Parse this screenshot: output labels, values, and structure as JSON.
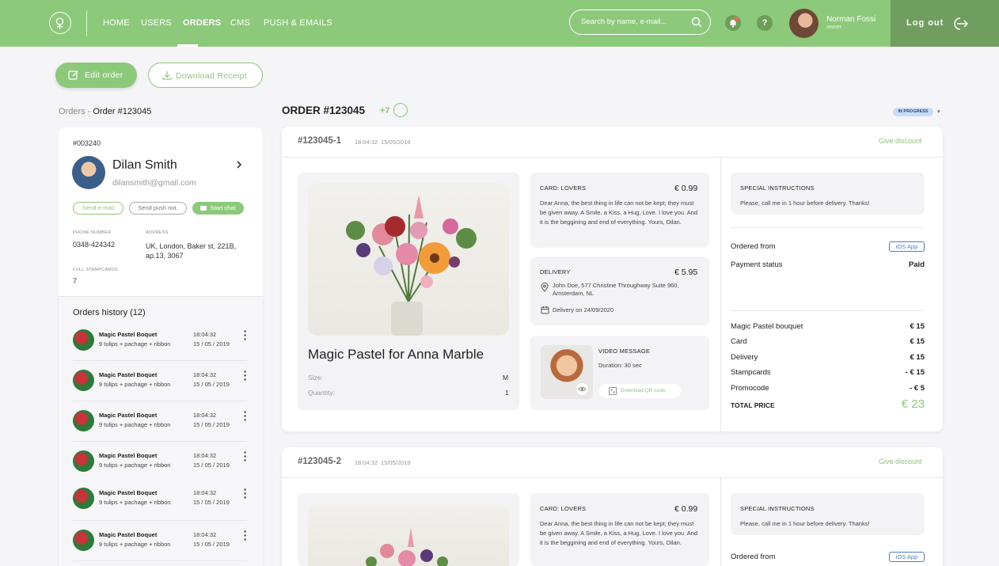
{
  "header": {
    "nav": [
      "HOME",
      "USERS",
      "ORDERS",
      "CMS",
      "PUSH & EMAILS"
    ],
    "active_nav": "ORDERS",
    "search_placeholder": "Search by name, e-mail...",
    "help_label": "?",
    "user_name": "Norman Fossi",
    "user_role": "owner",
    "logout_label": "Log out"
  },
  "actions": {
    "edit_label": "Edit order",
    "download_label": "Download Receipt"
  },
  "breadcrumb": {
    "parent": "Orders",
    "sep": " - ",
    "current": "Order #123045"
  },
  "customer": {
    "id": "#003240",
    "name": "Dilan Smith",
    "email": "dilansmith@gmail.com",
    "buttons": [
      "Send e-mail",
      "Send push not.",
      "Start chat"
    ],
    "phone_label": "PHONE NUMBER",
    "phone": "0348-424342",
    "address_label": "ADDRESS",
    "address_line1": "UK, London, Baker st, 221B,",
    "address_line2": "ap.13, 3067",
    "stamp_label": "FULL STAMPCARDS",
    "stamps": "7"
  },
  "history": {
    "title": "Orders history (12)",
    "items": [
      {
        "name": "Magic Pastel Boquet",
        "desc": "9 tulips + pachage + ribbon",
        "time": "18:04:32",
        "date": "15 / 05 / 2019"
      },
      {
        "name": "Magic Pastel Boquet",
        "desc": "9 tulips + pachage + ribbon",
        "time": "18:04:32",
        "date": "15 / 05 / 2019"
      },
      {
        "name": "Magic Pastel Boquet",
        "desc": "9 tulips + pachage + ribbon",
        "time": "18:04:32",
        "date": "15 / 05 / 2019"
      },
      {
        "name": "Magic Pastel Boquet",
        "desc": "9 tulips + pachage + ribbon",
        "time": "18:04:32",
        "date": "15 / 05 / 2019"
      },
      {
        "name": "Magic Pastel Boquet",
        "desc": "9 tulips + pachage + ribbon",
        "time": "18:04:32",
        "date": "15 / 05 / 2019"
      },
      {
        "name": "Magic Pastel Boquet",
        "desc": "9 tulips + pachage + ribbon",
        "time": "18:04:32",
        "date": "15 / 05 / 2019"
      }
    ]
  },
  "order": {
    "title": "ORDER #123045",
    "extra": "+7",
    "status": "IN PROGRESS",
    "items": [
      {
        "id": "#123045-1",
        "time": "18:04:32",
        "date": "15/05/2019",
        "give_discount": "Give discount",
        "product": "Magic Pastel for Anna Marble",
        "size_label": "Size:",
        "size": "M",
        "qty_label": "Quantity:",
        "qty": "1",
        "card_title": "CARD: LOVERS",
        "card_price": "€ 0.99",
        "card_text": "Dear Anna, the best thing in life can not be kept; they must be given away.  A Smile, a Kiss, a Hug, Love. I love you. And it is the beggining and end of everything. Yours, Dilan.",
        "delivery_title": "DELIVERY",
        "delivery_price": "€ 5.95",
        "delivery_address": "John Doe, 577 Christine Throughway Suite 960, Amsterdam, NL",
        "delivery_date": "Delivery on 24/09/2020",
        "video_title": "VIDEO MESSAGE",
        "video_duration": "Duration: 30 sec",
        "qr_label": "Download QR-code",
        "instr_title": "SPECIAL INSTRUCTIONS",
        "instr_text": "Please, call me in 1 hour before delivery. Thanks!",
        "ordered_from_label": "Ordered from",
        "ordered_from": "iOS App",
        "payment_label": "Payment status",
        "payment": "Paid",
        "summary": [
          {
            "k": "Magic Pastel bouquet",
            "v": "€ 15"
          },
          {
            "k": "Card",
            "v": "€ 15"
          },
          {
            "k": "Delivery",
            "v": "€ 15"
          },
          {
            "k": "Stampcards",
            "v": "- € 15"
          },
          {
            "k": "Promocode",
            "v": "- € 5"
          }
        ],
        "total_label": "TOTAL PRICE",
        "total": "€ 23"
      },
      {
        "id": "#123045-2",
        "time": "18:04:32",
        "date": "15/05/2019",
        "give_discount": "Give discount",
        "card_title": "CARD: LOVERS",
        "card_price": "€ 0.99",
        "card_text": "Dear Anna, the best thing in life can not be kept; they must be given away.  A Smile, a Kiss, a Hug, Love. I love you. And it is the beggining and end of everything. Yours, Dilan.",
        "instr_title": "SPECIAL INSTRUCTIONS",
        "instr_text": "Please, call me in 1 hour before delivery. Thanks!",
        "ordered_from_label": "Ordered from",
        "ordered_from": "iOS App"
      }
    ]
  },
  "colors": {
    "brand": "#8dc97a",
    "brand_dark": "#6f9e5e",
    "status_bg": "#c8dcf6",
    "ios_blue": "#4a7fd0"
  },
  "icons": [
    "flower-logo-icon",
    "search-icon",
    "bell-icon",
    "help-icon",
    "logout-icon",
    "edit-icon",
    "download-icon",
    "chevron-right-icon",
    "chat-icon",
    "more-vertical-icon",
    "location-icon",
    "calendar-icon",
    "eye-icon",
    "qr-icon",
    "caret-down-icon"
  ]
}
